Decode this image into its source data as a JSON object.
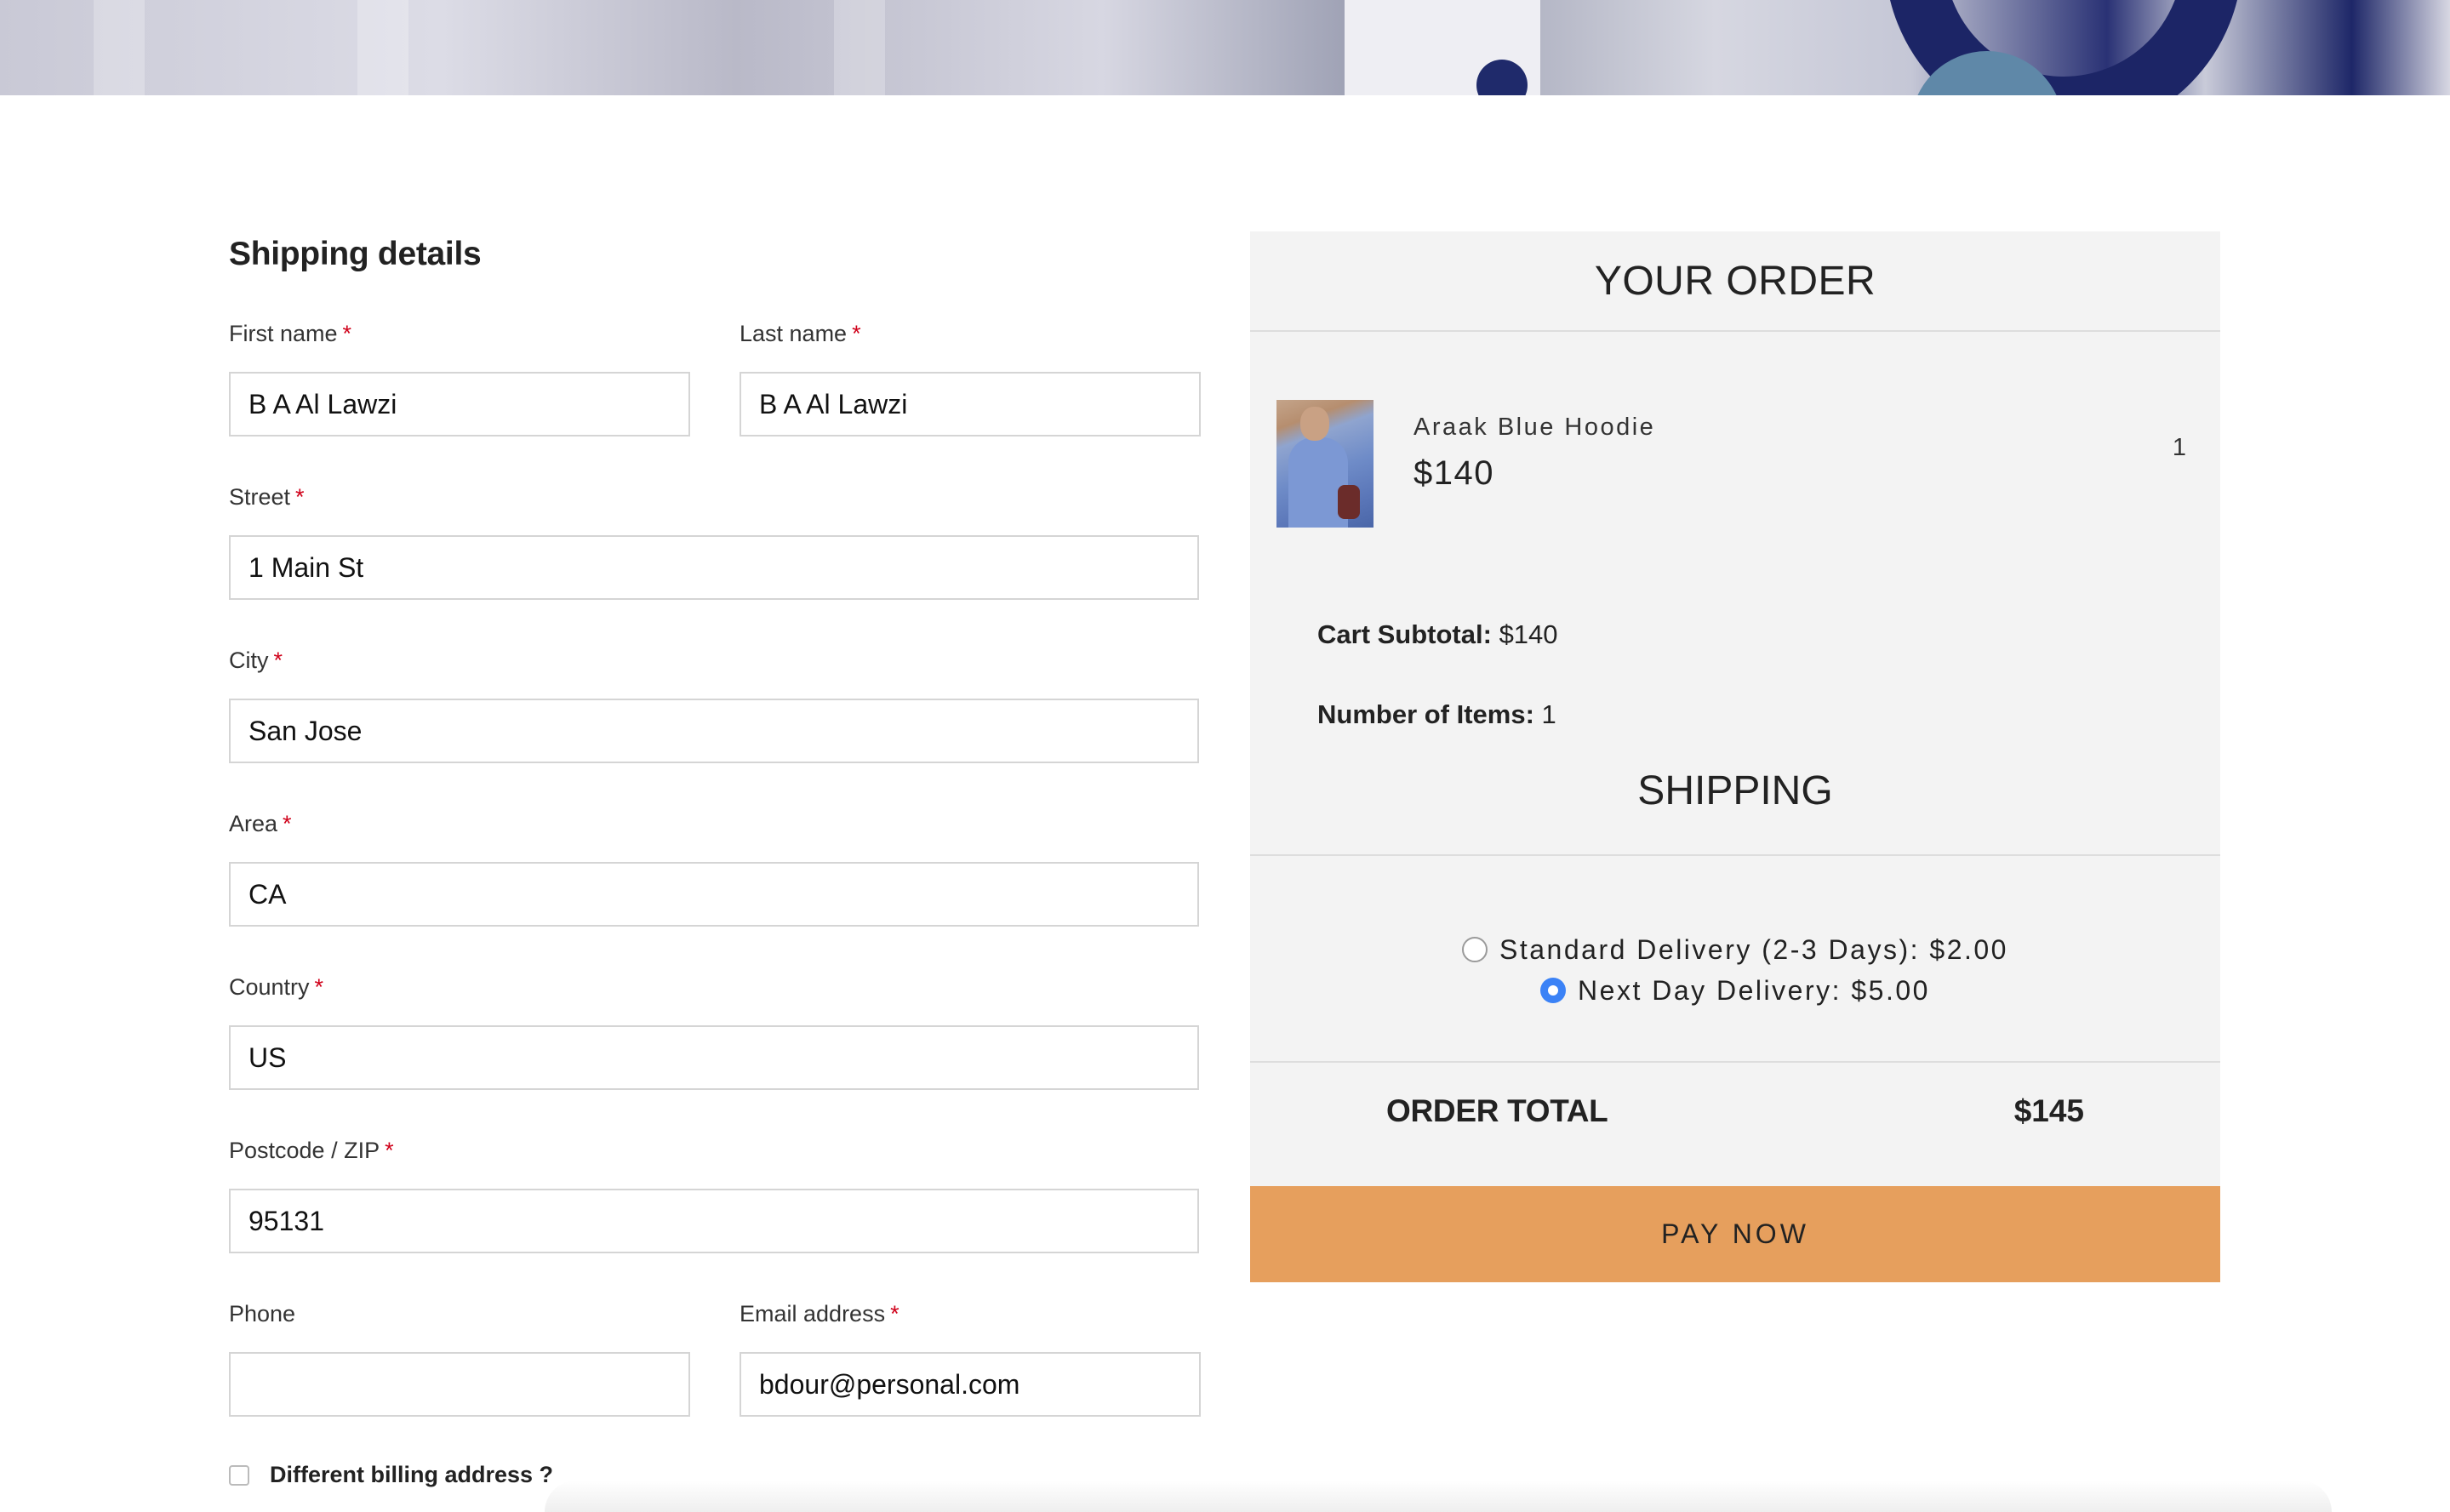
{
  "shipping": {
    "title": "Shipping details",
    "fields": {
      "first_name": {
        "label": "First name",
        "required_mark": "*",
        "value": "B A Al Lawzi"
      },
      "last_name": {
        "label": "Last name",
        "required_mark": "*",
        "value": "B A Al Lawzi"
      },
      "street": {
        "label": "Street",
        "required_mark": "*",
        "value": "1 Main St"
      },
      "city": {
        "label": "City",
        "required_mark": "*",
        "value": "San Jose"
      },
      "area": {
        "label": "Area",
        "required_mark": "*",
        "value": "CA"
      },
      "country": {
        "label": "Country",
        "required_mark": "*",
        "value": "US"
      },
      "postcode": {
        "label": "Postcode / ZIP",
        "required_mark": "*",
        "value": "95131"
      },
      "phone": {
        "label": "Phone",
        "value": ""
      },
      "email": {
        "label": "Email address",
        "required_mark": "*",
        "value": "bdour@personal.com"
      }
    },
    "billing_checkbox": {
      "label": "Different billing address ?",
      "checked": false
    }
  },
  "order": {
    "title": "YOUR ORDER",
    "item": {
      "name": "Araak Blue Hoodie",
      "price": "$140",
      "quantity": "1"
    },
    "subtotal": {
      "label": "Cart Subtotal:",
      "value": "$140"
    },
    "items_count": {
      "label": "Number of Items:",
      "value": "1"
    },
    "shipping_title": "SHIPPING",
    "shipping_options": [
      {
        "label": "Standard Delivery (2-3 Days): $2.00",
        "checked": false
      },
      {
        "label": "Next Day Delivery: $5.00",
        "checked": true
      }
    ],
    "total": {
      "label": "ORDER TOTAL",
      "value": "$145"
    },
    "pay_button": "PAY NOW"
  },
  "colors": {
    "accent": "#e69f5d",
    "panel_bg": "#f3f3f3",
    "required": "#d0021b",
    "radio_checked": "#3b82f6"
  }
}
